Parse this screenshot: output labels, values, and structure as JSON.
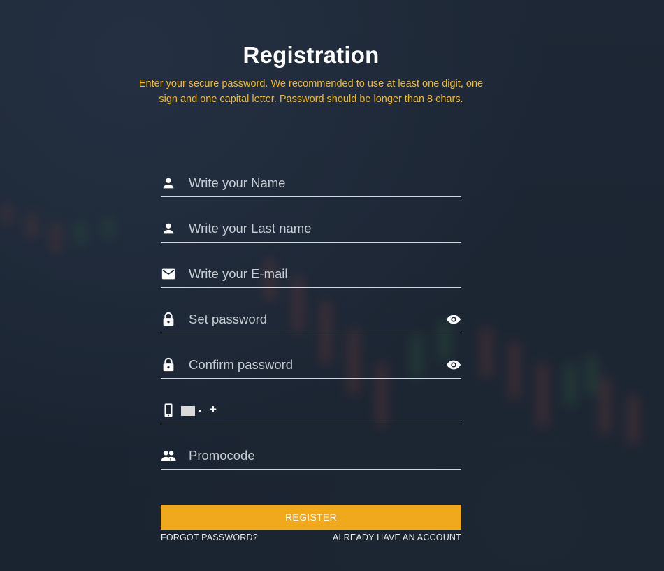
{
  "header": {
    "title": "Registration",
    "subtitle": "Enter your secure password. We recommended to use at least one digit, one sign and one capital letter. Password should be longer than 8 chars."
  },
  "form": {
    "name": {
      "placeholder": "Write your Name",
      "icon": "person-icon",
      "value": ""
    },
    "last_name": {
      "placeholder": "Write your Last name",
      "icon": "person-icon",
      "value": ""
    },
    "email": {
      "placeholder": "Write your E-mail",
      "icon": "email-icon",
      "value": ""
    },
    "password": {
      "placeholder": "Set password",
      "icon": "lock-icon",
      "toggle_icon": "eye-icon",
      "value": ""
    },
    "confirm_password": {
      "placeholder": "Confirm password",
      "icon": "lock-icon",
      "toggle_icon": "eye-icon",
      "value": ""
    },
    "phone": {
      "icon": "mobile-phone-icon",
      "country_flag": "flag-placeholder",
      "prefix": "+",
      "value": ""
    },
    "promocode": {
      "placeholder": "Promocode",
      "icon": "people-icon",
      "value": ""
    }
  },
  "actions": {
    "register_label": "REGISTER",
    "forgot_password_label": "FORGOT PASSWORD?",
    "already_have_account_label": "ALREADY HAVE AN ACCOUNT"
  },
  "colors": {
    "background": "#1b2431",
    "accent": "#f0a81c",
    "subtitle": "#f0b829",
    "text": "#ffffff",
    "field_border": "#cfd5dc"
  }
}
